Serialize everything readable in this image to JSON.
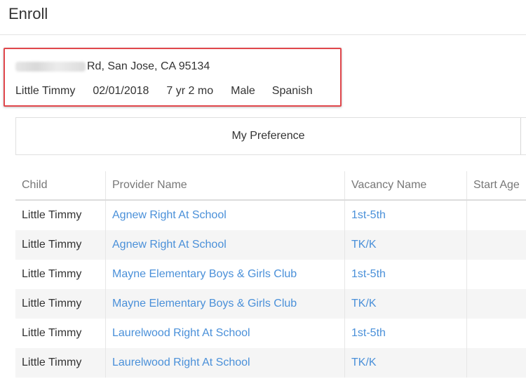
{
  "header": {
    "title": "Enroll"
  },
  "info": {
    "address_suffix": "Rd, San Jose, CA 95134",
    "child_name": "Little Timmy",
    "dob": "02/01/2018",
    "age": "7 yr 2 mo",
    "gender": "Male",
    "language": "Spanish"
  },
  "tabs": [
    {
      "label": "My Preference"
    }
  ],
  "table": {
    "headers": {
      "child": "Child",
      "provider": "Provider Name",
      "vacancy": "Vacancy Name",
      "start_age": "Start Age"
    },
    "rows": [
      {
        "child": "Little Timmy",
        "provider": "Agnew Right At School",
        "vacancy": "1st-5th"
      },
      {
        "child": "Little Timmy",
        "provider": "Agnew Right At School",
        "vacancy": "TK/K"
      },
      {
        "child": "Little Timmy",
        "provider": "Mayne Elementary Boys & Girls Club",
        "vacancy": "1st-5th"
      },
      {
        "child": "Little Timmy",
        "provider": "Mayne Elementary Boys & Girls Club",
        "vacancy": "TK/K"
      },
      {
        "child": "Little Timmy",
        "provider": "Laurelwood Right At School",
        "vacancy": "1st-5th"
      },
      {
        "child": "Little Timmy",
        "provider": "Laurelwood Right At School",
        "vacancy": "TK/K"
      }
    ]
  }
}
